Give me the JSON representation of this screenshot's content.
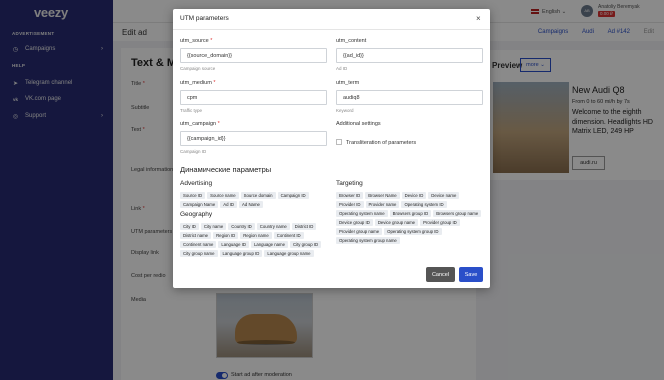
{
  "app": {
    "logo": "veezy"
  },
  "sidebar": {
    "section_advertisement": "ADVERTISEMENT",
    "section_help": "HELP",
    "items": [
      {
        "label": "Campaigns",
        "icon": "clock-icon"
      },
      {
        "label": "Telegram channel",
        "icon": "telegram-icon"
      },
      {
        "label": "VK.com page",
        "icon": "vk-icon"
      },
      {
        "label": "Support",
        "icon": "support-icon"
      }
    ]
  },
  "header": {
    "language": "English",
    "user_name": "Anatoliy Beremyak",
    "balance": "0.00 ₽",
    "avatar_initials": "AB"
  },
  "subheader": {
    "title": "Edit ad",
    "breadcrumbs": [
      "Campaigns",
      "Audi",
      "Ad #142",
      "Edit"
    ]
  },
  "form": {
    "section_title": "Text & Me",
    "labels": {
      "title": "Title",
      "subtitle": "Subtitle",
      "text": "Text",
      "legal": "Legal information",
      "link": "Link",
      "utm": "UTM parameters",
      "display_link": "Display link",
      "cost": "Cost per redio",
      "media": "Media"
    },
    "toggle_label": "Start ad after moderation"
  },
  "preview": {
    "title": "Preview",
    "more_button": "more",
    "heading": "New Audi Q8",
    "subheading": "From 0 to 60 mi/h by 7s",
    "text": "Welcome to the eighth dimension. Headlights HD Matrix LED, 249 HP",
    "link_button": "audi.ru"
  },
  "modal": {
    "title": "UTM parameters",
    "fields": {
      "utm_source": {
        "label": "utm_source",
        "value": "{{source_domain}}",
        "hint": "Campaign source"
      },
      "utm_content": {
        "label": "utm_content",
        "value": "{{ad_id}}",
        "hint": "Ad ID"
      },
      "utm_medium": {
        "label": "utm_medium",
        "value": "cpm",
        "hint": "Traffic type"
      },
      "utm_term": {
        "label": "utm_term",
        "value": "audiq8",
        "hint": "Keyword"
      },
      "utm_campaign": {
        "label": "utm_campaign",
        "value": "{{campaign_id}}",
        "hint": "Campaign ID"
      }
    },
    "additional_settings": "Additional settings",
    "transliteration": "Transliteration of parameters",
    "dynamic_title": "Динамические параметры",
    "sections": {
      "advertising": {
        "title": "Advertising",
        "tags": [
          "Source ID",
          "Source name",
          "Source domain",
          "Campaign ID",
          "Campaign Name",
          "Ad ID",
          "Ad Name"
        ]
      },
      "geography": {
        "title": "Geography",
        "tags": [
          "City ID",
          "City name",
          "Country ID",
          "Country name",
          "District ID",
          "District name",
          "Region ID",
          "Region name",
          "Continent ID",
          "Continent name",
          "Language ID",
          "Language name",
          "City group ID",
          "City group name",
          "Language group ID",
          "Language group name"
        ]
      },
      "targeting": {
        "title": "Targeting",
        "tags": [
          "Browser ID",
          "Browser Name",
          "Device ID",
          "Device name",
          "Provider ID",
          "Provider name",
          "Operating system ID",
          "Operating system name",
          "Browsers group ID",
          "Browsers group name",
          "Device group ID",
          "Device group name",
          "Provider group ID",
          "Provider group name",
          "Operating system group ID",
          "Operating system group name"
        ]
      }
    },
    "cancel": "Cancel",
    "save": "Save"
  },
  "colors": {
    "accent": "#2a4fc9",
    "sidebar": "#2a2f7d",
    "required": "#d33333",
    "cancel": "#555555"
  }
}
